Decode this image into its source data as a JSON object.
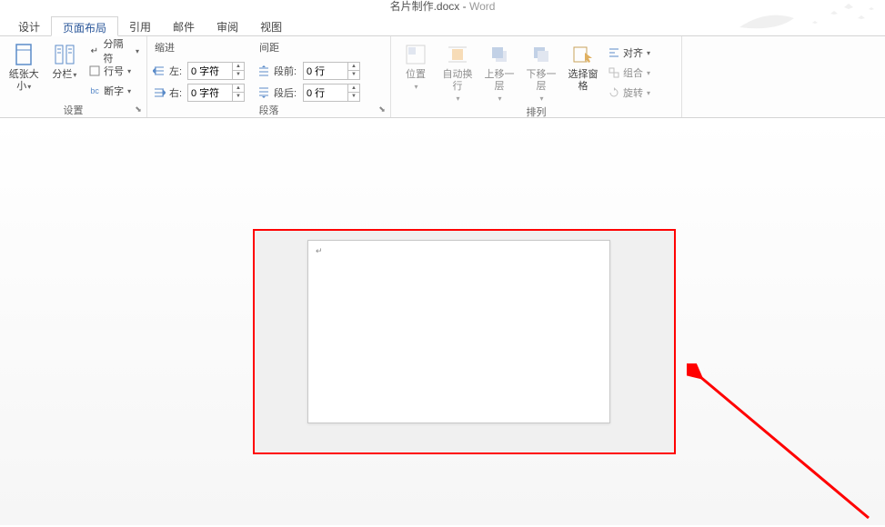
{
  "title": {
    "doc": "名片制作.docx",
    "app": "Word"
  },
  "tabs": [
    {
      "label": "设计",
      "active": false
    },
    {
      "label": "页面布局",
      "active": true
    },
    {
      "label": "引用",
      "active": false
    },
    {
      "label": "邮件",
      "active": false
    },
    {
      "label": "审阅",
      "active": false
    },
    {
      "label": "视图",
      "active": false
    }
  ],
  "ribbon": {
    "setup": {
      "size": "纸张大小",
      "columns": "分栏",
      "breaks": "分隔符",
      "lineno": "行号",
      "hyphen": "断字",
      "group": "设置"
    },
    "paragraph": {
      "indent_title": "缩进",
      "spacing_title": "间距",
      "left_label": "左:",
      "right_label": "右:",
      "before_label": "段前:",
      "after_label": "段后:",
      "left_value": "0 字符",
      "right_value": "0 字符",
      "before_value": "0 行",
      "after_value": "0 行",
      "group": "段落"
    },
    "arrange": {
      "position": "位置",
      "wrap": "自动换行",
      "forward": "上移一层",
      "backward": "下移一层",
      "selection": "选择窗格",
      "align": "对齐",
      "group_btn": "组合",
      "rotate": "旋转",
      "group": "排列"
    }
  }
}
